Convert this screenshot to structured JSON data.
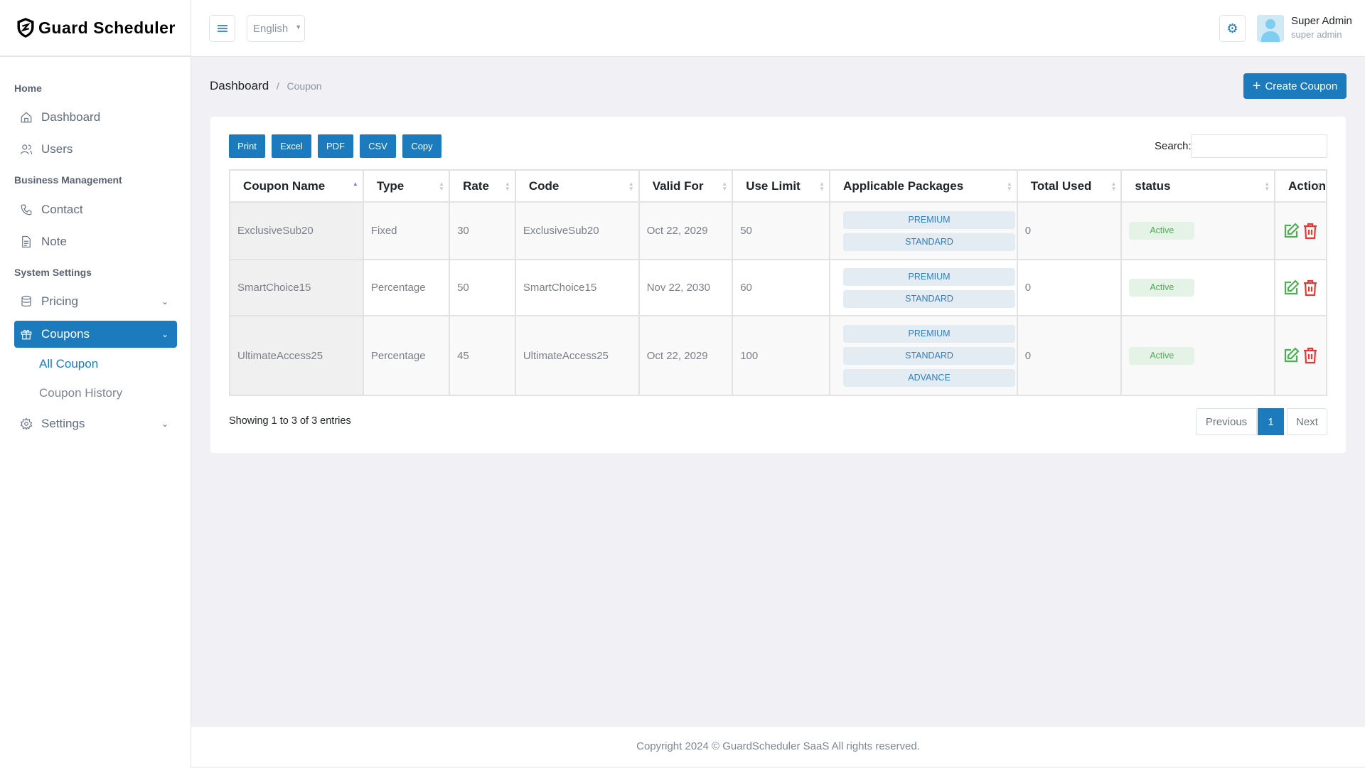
{
  "app": {
    "name": "Guard Scheduler"
  },
  "sidebar": {
    "sections": [
      "Home",
      "Business Management",
      "System Settings"
    ],
    "items": [
      {
        "label": "Dashboard",
        "icon": "home-icon"
      },
      {
        "label": "Users",
        "icon": "users-icon"
      },
      {
        "label": "Contact",
        "icon": "phone-icon"
      },
      {
        "label": "Note",
        "icon": "note-icon"
      },
      {
        "label": "Pricing",
        "icon": "database-icon"
      },
      {
        "label": "Coupons",
        "icon": "gift-icon"
      },
      {
        "label": "Settings",
        "icon": "gear-icon"
      }
    ],
    "coupon_sub": [
      "All Coupon",
      "Coupon History"
    ]
  },
  "header": {
    "language": "English",
    "user_name": "Super Admin",
    "user_role": "super admin"
  },
  "breadcrumb": {
    "root": "Dashboard",
    "current": "Coupon"
  },
  "create_button": "Create Coupon",
  "export_buttons": [
    "Print",
    "Excel",
    "PDF",
    "CSV",
    "Copy"
  ],
  "search": {
    "label": "Search:",
    "value": ""
  },
  "table": {
    "columns": [
      "Coupon Name",
      "Type",
      "Rate",
      "Code",
      "Valid For",
      "Use Limit",
      "Applicable Packages",
      "Total Used",
      "status",
      "Action"
    ],
    "rows": [
      {
        "name": "ExclusiveSub20",
        "type": "Fixed",
        "rate": "30",
        "code": "ExclusiveSub20",
        "valid": "Oct 22, 2029",
        "limit": "50",
        "packages": [
          "PREMIUM",
          "STANDARD"
        ],
        "used": "0",
        "status": "Active"
      },
      {
        "name": "SmartChoice15",
        "type": "Percentage",
        "rate": "50",
        "code": "SmartChoice15",
        "valid": "Nov 22, 2030",
        "limit": "60",
        "packages": [
          "PREMIUM",
          "STANDARD"
        ],
        "used": "0",
        "status": "Active"
      },
      {
        "name": "UltimateAccess25",
        "type": "Percentage",
        "rate": "45",
        "code": "UltimateAccess25",
        "valid": "Oct 22, 2029",
        "limit": "100",
        "packages": [
          "PREMIUM",
          "STANDARD",
          "ADVANCE"
        ],
        "used": "0",
        "status": "Active"
      }
    ]
  },
  "info": "Showing 1 to 3 of 3 entries",
  "pagination": {
    "previous": "Previous",
    "current": "1",
    "next": "Next"
  },
  "footer": "Copyright 2024 © GuardScheduler SaaS All rights reserved.",
  "colors": {
    "primary": "#1b7bbd",
    "success": "#4caf50",
    "danger": "#e53935"
  }
}
